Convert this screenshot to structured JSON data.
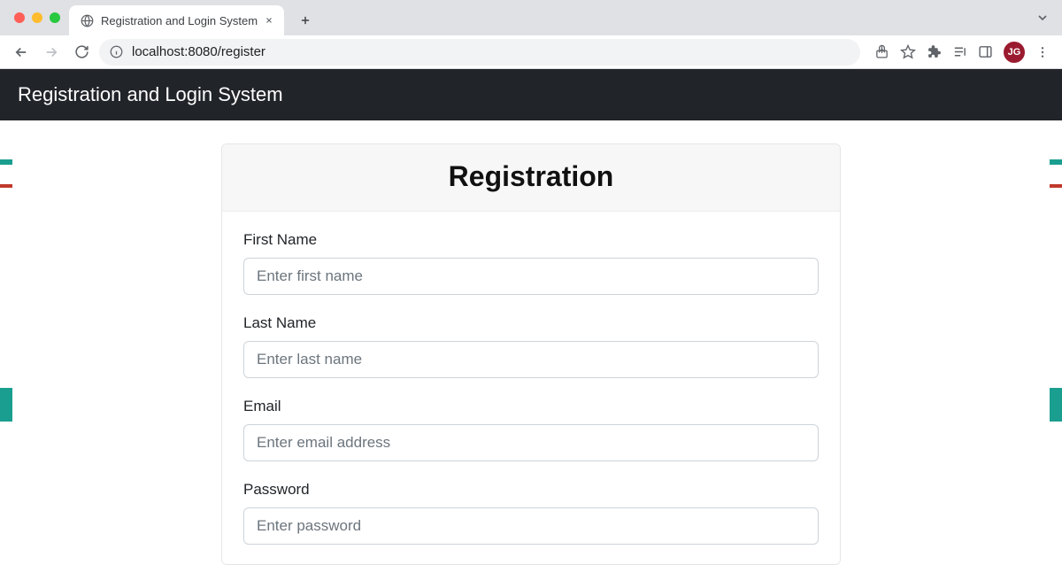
{
  "browser": {
    "tab_title": "Registration and Login System",
    "url": "localhost:8080/register",
    "profile_initials": "JG"
  },
  "header": {
    "title": "Registration and Login System"
  },
  "card": {
    "title": "Registration"
  },
  "form": {
    "first_name": {
      "label": "First Name",
      "placeholder": "Enter first name"
    },
    "last_name": {
      "label": "Last Name",
      "placeholder": "Enter last name"
    },
    "email": {
      "label": "Email",
      "placeholder": "Enter email address"
    },
    "password": {
      "label": "Password",
      "placeholder": "Enter password"
    }
  }
}
